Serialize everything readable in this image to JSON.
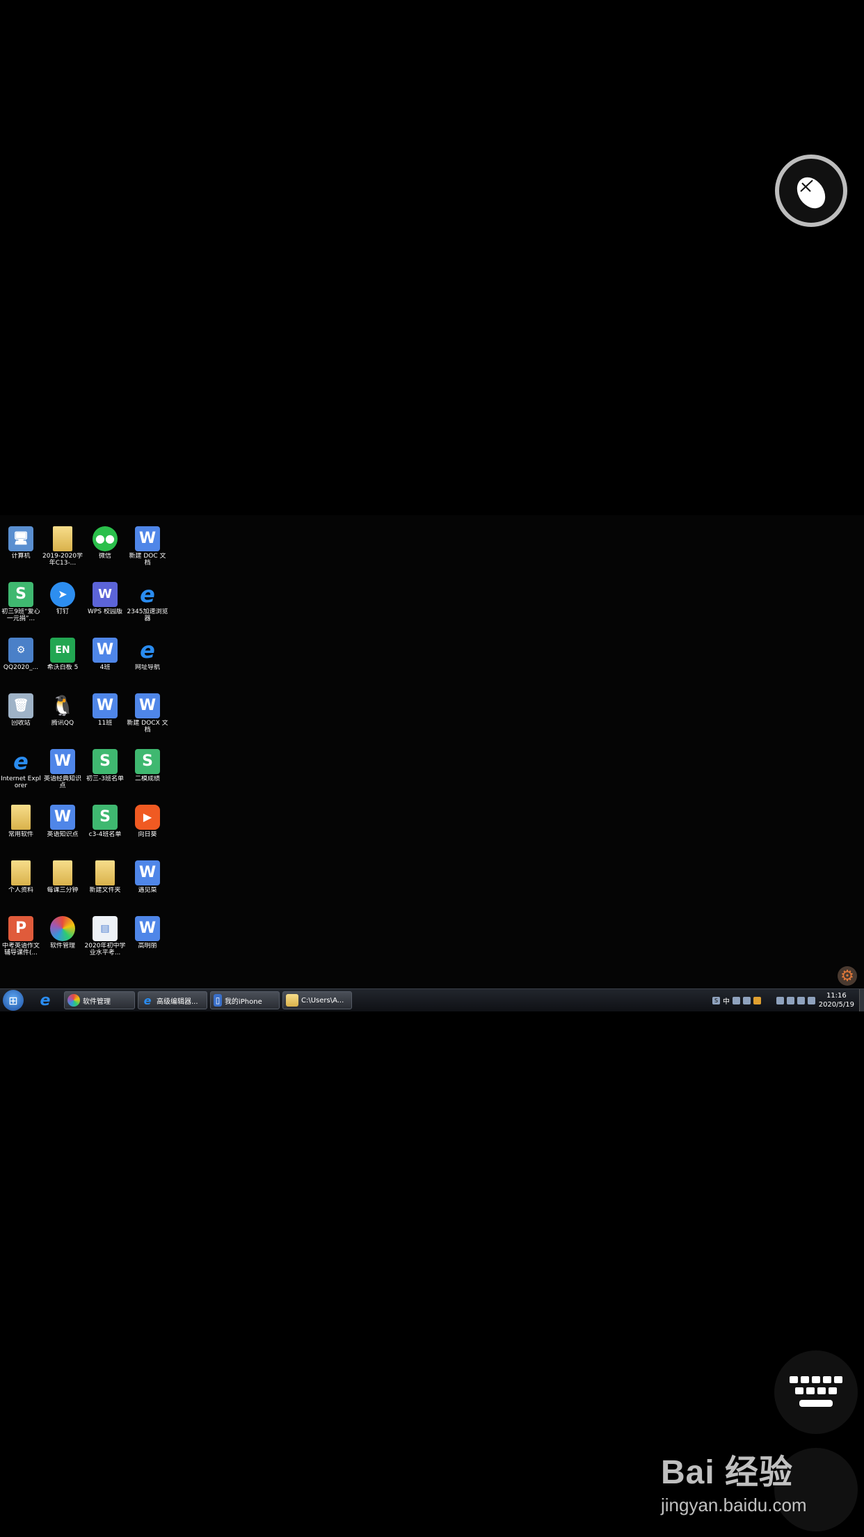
{
  "desktop_icons": [
    {
      "label": "计算机",
      "icon": "computer-icon"
    },
    {
      "label": "2019-2020学年C13-...",
      "icon": "folder-icon"
    },
    {
      "label": "微信",
      "icon": "wechat-icon"
    },
    {
      "label": "新建 DOC 文档",
      "icon": "wps-writer-icon"
    },
    {
      "label": "初三9班“爱心一元捐”...",
      "icon": "wps-sheet-icon"
    },
    {
      "label": "钉钉",
      "icon": "dingtalk-icon"
    },
    {
      "label": "WPS 校园版",
      "icon": "wps-campus-icon"
    },
    {
      "label": "2345加速浏览器",
      "icon": "browser-2345-icon"
    },
    {
      "label": "QQ2020_...",
      "icon": "qq-installer-icon"
    },
    {
      "label": "希沃白板 5",
      "icon": "seewo-en-icon"
    },
    {
      "label": "4班",
      "icon": "wps-writer-icon"
    },
    {
      "label": "网址导航",
      "icon": "ie-icon"
    },
    {
      "label": "回收站",
      "icon": "recycle-bin-icon"
    },
    {
      "label": "腾讯QQ",
      "icon": "qq-icon"
    },
    {
      "label": "11班",
      "icon": "wps-writer-icon"
    },
    {
      "label": "新建 DOCX 文档",
      "icon": "wps-writer-icon"
    },
    {
      "label": "Internet Explorer",
      "icon": "ie-icon"
    },
    {
      "label": "英语经典知识点",
      "icon": "wps-writer-icon"
    },
    {
      "label": "初三-3班名单",
      "icon": "wps-sheet-icon"
    },
    {
      "label": "二模成绩",
      "icon": "wps-sheet-icon"
    },
    {
      "label": "常用软件",
      "icon": "folder-icon"
    },
    {
      "label": "英语知识点",
      "icon": "wps-writer-icon"
    },
    {
      "label": "c3-4班名单",
      "icon": "wps-sheet-icon"
    },
    {
      "label": "向日葵",
      "icon": "sunflower-icon"
    },
    {
      "label": "个人资料",
      "icon": "folder-icon"
    },
    {
      "label": "每课三分钟",
      "icon": "folder-icon"
    },
    {
      "label": "新建文件夹",
      "icon": "folder-icon"
    },
    {
      "label": "遇见菜",
      "icon": "wps-writer-icon"
    },
    {
      "label": "中考英语作文辅导课件(...",
      "icon": "wps-presentation-icon"
    },
    {
      "label": "软件管理",
      "icon": "software-manager-icon"
    },
    {
      "label": "2020年初中学业水平考...",
      "icon": "document-icon"
    },
    {
      "label": "高明丽",
      "icon": "wps-writer-icon"
    }
  ],
  "taskbar": {
    "items": [
      {
        "label": "软件管理",
        "icon": "software-manager-icon"
      },
      {
        "label": "高级编辑器...",
        "icon": "ie-icon"
      },
      {
        "label": "我的iPhone",
        "icon": "phone-icon"
      },
      {
        "label": "C:\\Users\\A...",
        "icon": "folder-icon"
      }
    ],
    "tray_ime": "中",
    "clock_time": "11:16",
    "clock_date": "2020/5/19"
  },
  "watermark": {
    "logo": "Bai 经验",
    "url": "jingyan.baidu.com"
  },
  "colors": {
    "background": "#000000",
    "wps_writer": "#4f86e8",
    "wps_sheet": "#3fb870",
    "wps_presentation": "#e05b3b"
  }
}
